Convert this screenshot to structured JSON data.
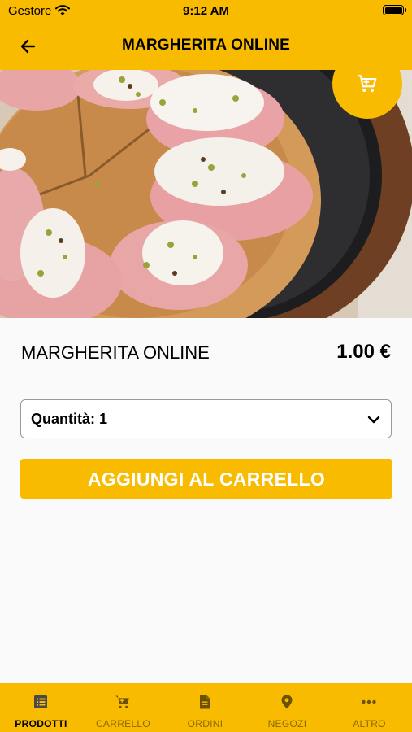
{
  "status_bar": {
    "carrier": "Gestore",
    "time": "9:12 AM"
  },
  "nav": {
    "title": "MARGHERITA ONLINE",
    "back_icon": "arrow-left-icon"
  },
  "hero": {
    "image": "pizza-photo",
    "cart_icon": "shopping-cart-icon",
    "page_count": 1,
    "current_page": 1
  },
  "product": {
    "name": "MARGHERITA ONLINE",
    "price": "1.00 €"
  },
  "quantity": {
    "label": "Quantità: 1",
    "icon": "chevron-down-icon"
  },
  "add_button": {
    "label": "AGGIUNGI AL CARRELLO"
  },
  "tabs": [
    {
      "label": "PRODOTTI",
      "icon": "list-icon",
      "active": true
    },
    {
      "label": "CARRELLO",
      "icon": "cart-icon",
      "active": false
    },
    {
      "label": "ORDINI",
      "icon": "document-icon",
      "active": false
    },
    {
      "label": "NEGOZI",
      "icon": "location-pin-icon",
      "active": false
    },
    {
      "label": "ALTRO",
      "icon": "more-dots-icon",
      "active": false
    }
  ],
  "colors": {
    "accent": "#f8bb00",
    "background": "#fafafa",
    "text": "#000000",
    "button_text": "#ffffff"
  }
}
